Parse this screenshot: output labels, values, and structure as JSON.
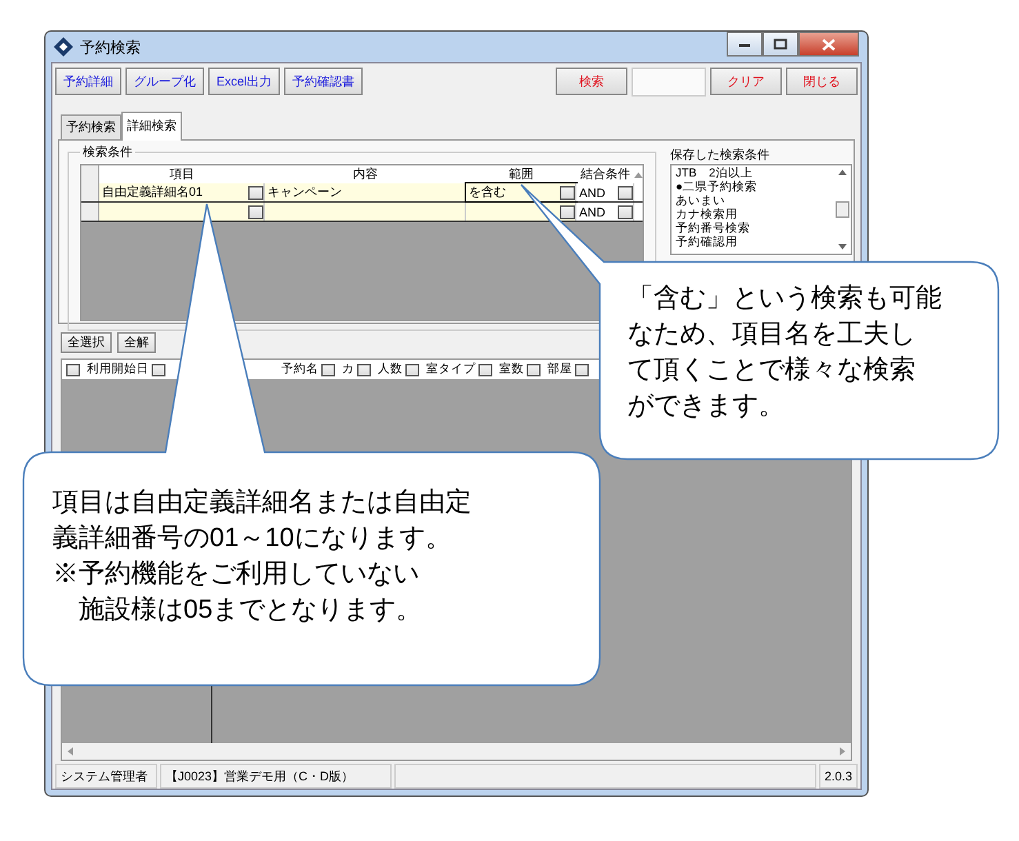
{
  "window": {
    "title": "予約検索"
  },
  "toolbar": {
    "left_buttons": [
      "予約詳細",
      "グループ化",
      "Excel出力",
      "予約確認書"
    ],
    "right_buttons": [
      {
        "label": "検索",
        "kind": "button"
      },
      {
        "kind": "blank"
      },
      {
        "label": "クリア",
        "kind": "button"
      },
      {
        "label": "閉じる",
        "kind": "button"
      }
    ]
  },
  "tabs": [
    {
      "label": "予約検索",
      "selected": false
    },
    {
      "label": "詳細検索",
      "selected": true
    }
  ],
  "conditions": {
    "title": "検索条件",
    "columns": [
      "項目",
      "内容",
      "範囲",
      "結合条件"
    ],
    "rows": [
      {
        "item": "自由定義詳細名01",
        "content": "キャンペーン",
        "range": "を含む",
        "join": "AND"
      },
      {
        "join": "AND"
      }
    ]
  },
  "saved": {
    "title": "保存した検索条件",
    "items": [
      "JTB　2泊以上",
      "●二県予約検索",
      "あいまい",
      "カナ検索用",
      "予約番号検索",
      "予約確認用"
    ]
  },
  "select_buttons": [
    "全選択",
    "全解"
  ],
  "list_columns": [
    "利用開始日",
    "予約名",
    "カ",
    "人数",
    "室タイプ",
    "室数",
    "部屋"
  ],
  "status_bar": [
    "システム管理者",
    "【J0023】営業デモ用（C・D版）",
    "2.0.3"
  ],
  "callouts": [
    {
      "lines": [
        "項目は自由定義詳細名または自由定",
        "義詳細番号の01～10になります。"
      ],
      "note_lines": [
        "※予約機能をご利用していない",
        "施設様は05までとなります。"
      ]
    },
    {
      "lines": [
        "「含む」という検索も可能",
        "なため、項目名を工夫し",
        "て頂くことで様々な検索",
        "ができます。"
      ]
    }
  ]
}
